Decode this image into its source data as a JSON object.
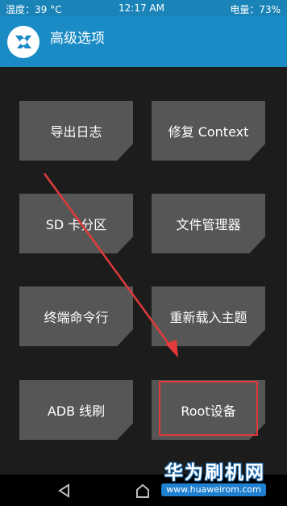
{
  "status_bar": {
    "temperature": "温度：39 °C",
    "time": "12:17 AM",
    "battery": "电量：73%"
  },
  "header": {
    "title": "高级选项",
    "logo_icon": "twrp-logo-icon"
  },
  "tiles": [
    {
      "label": "导出日志"
    },
    {
      "label": "修复 Context"
    },
    {
      "label": "SD 卡分区"
    },
    {
      "label": "文件管理器"
    },
    {
      "label": "终端命令行"
    },
    {
      "label": "重新载入主题"
    },
    {
      "label": "ADB 线刷"
    },
    {
      "label": "Root设备"
    }
  ],
  "annotation": {
    "highlight_color": "#e23a3a",
    "arrow_color": "#e23a3a"
  },
  "navbar": {
    "back_icon": "back-triangle-icon",
    "home_icon": "home-icon"
  },
  "watermark": {
    "title": "华为刷机网",
    "url": "www.huaweirom.com"
  },
  "colors": {
    "accent": "#1b8bc6",
    "tile": "#565656",
    "background": "#1c1c1c"
  }
}
